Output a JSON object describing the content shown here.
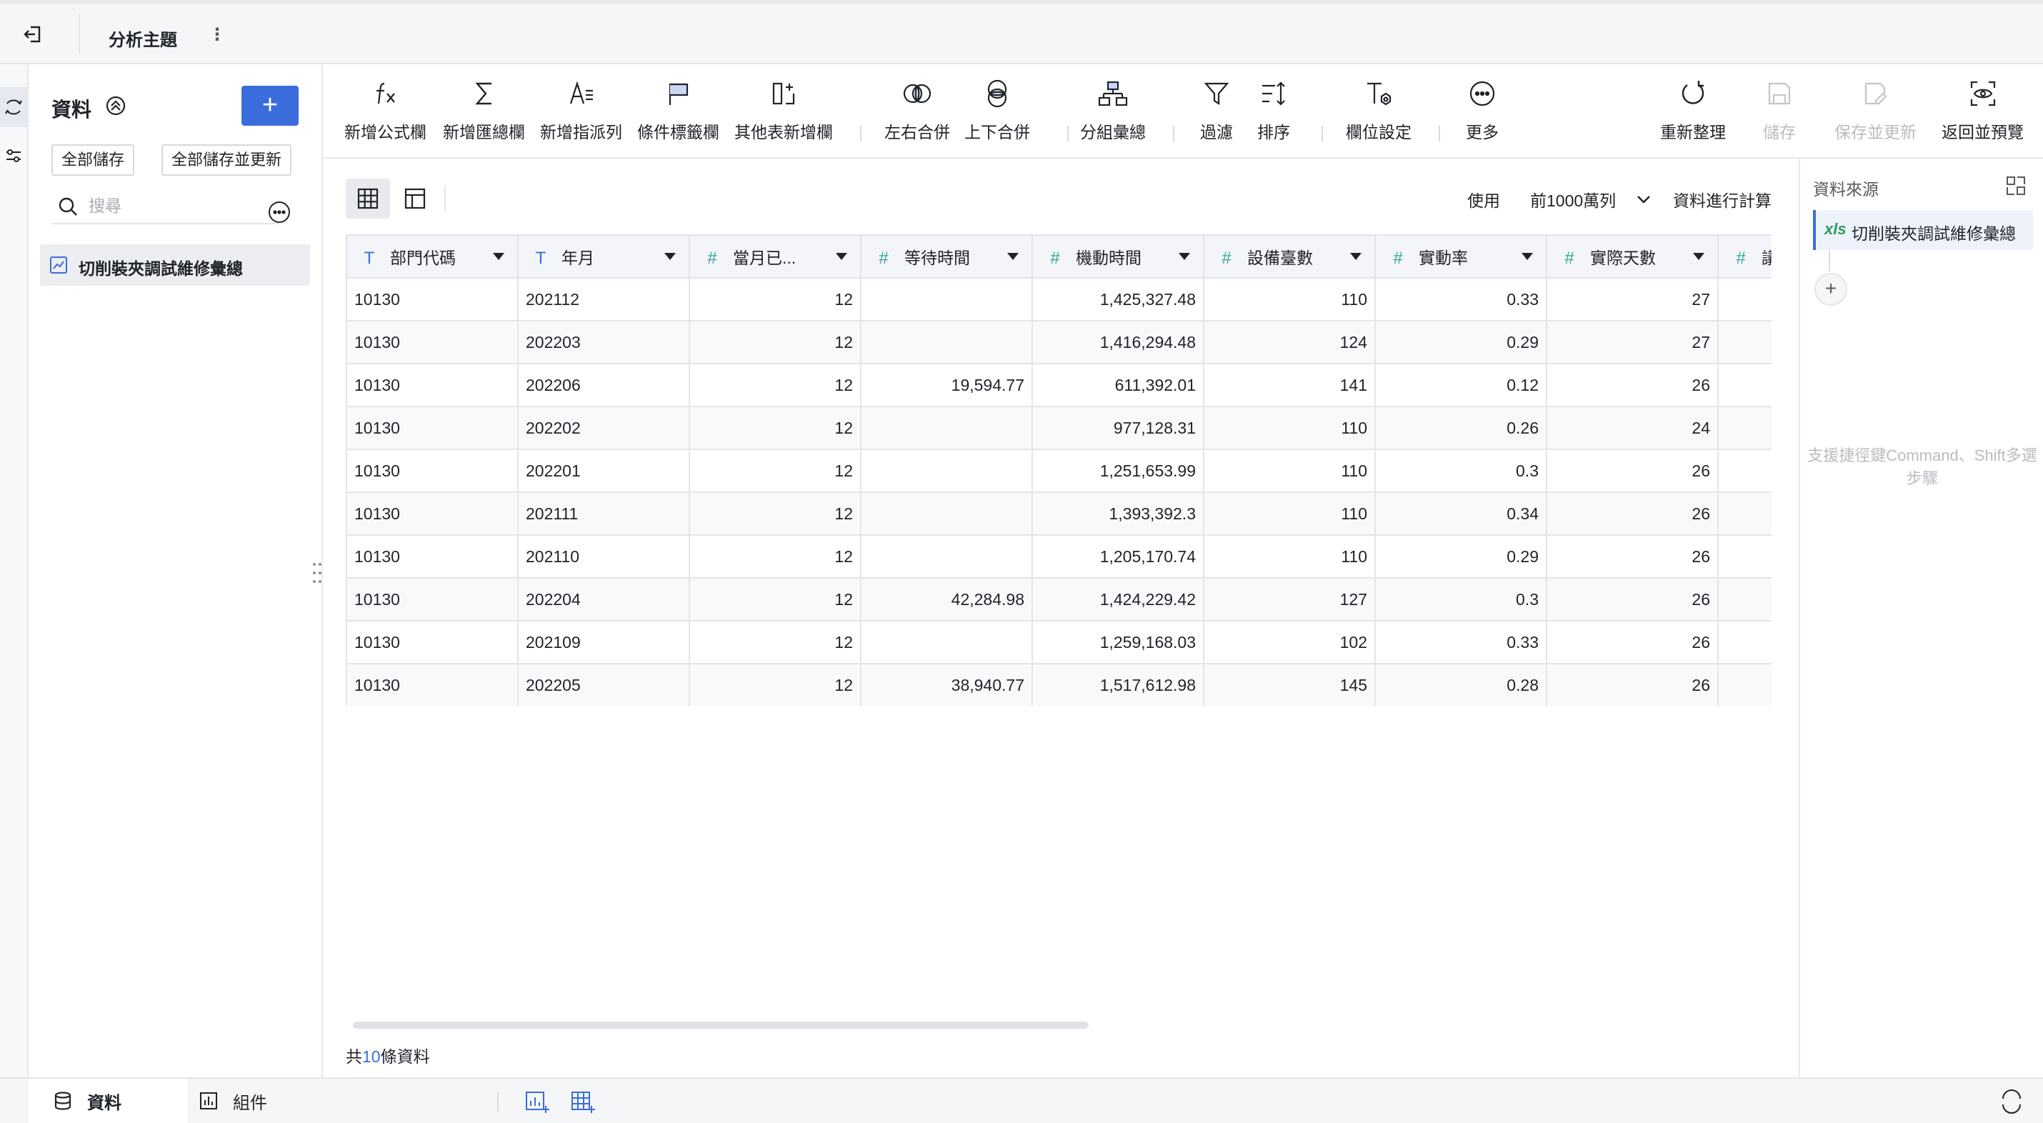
{
  "header": {
    "title": "分析主題",
    "kebab": "⋮"
  },
  "left_panel": {
    "title": "資料",
    "add_label": "+",
    "save_all": "全部儲存",
    "save_all_update": "全部儲存並更新",
    "search_placeholder": "搜尋",
    "dataset_name": "切削裝夾調試維修彙總"
  },
  "toolbar": {
    "add_formula": "新增公式欄",
    "add_summary": "新增匯總欄",
    "add_assign": "新增指派列",
    "condition_tag": "條件標籤欄",
    "other_table": "其他表新增欄",
    "lr_merge": "左右合併",
    "ud_merge": "上下合併",
    "group_summary": "分組彙總",
    "filter": "過濾",
    "sort": "排序",
    "field_settings": "欄位設定",
    "more": "更多",
    "refresh": "重新整理",
    "save": "儲存",
    "save_update": "保存並更新",
    "return_preview": "返回並預覽"
  },
  "main": {
    "use_label": "使用",
    "rows_option": "前1000萬列",
    "calc_label": "資料進行計算",
    "total_prefix": "共",
    "total_count": "10",
    "total_suffix": "條資料"
  },
  "table": {
    "columns": [
      {
        "label": "部門代碼",
        "type": "T"
      },
      {
        "label": "年月",
        "type": "T"
      },
      {
        "label": "當月已...",
        "type": "#"
      },
      {
        "label": "等待時間",
        "type": "#"
      },
      {
        "label": "機動時間",
        "type": "#"
      },
      {
        "label": "設備臺數",
        "type": "#"
      },
      {
        "label": "實動率",
        "type": "#"
      },
      {
        "label": "實際天數",
        "type": "#"
      },
      {
        "label": "議",
        "type": "#"
      }
    ],
    "rows": [
      [
        "10130",
        "202112",
        "12",
        "",
        "1,425,327.48",
        "110",
        "0.33",
        "27",
        ""
      ],
      [
        "10130",
        "202203",
        "12",
        "",
        "1,416,294.48",
        "124",
        "0.29",
        "27",
        ""
      ],
      [
        "10130",
        "202206",
        "12",
        "19,594.77",
        "611,392.01",
        "141",
        "0.12",
        "26",
        ""
      ],
      [
        "10130",
        "202202",
        "12",
        "",
        "977,128.31",
        "110",
        "0.26",
        "24",
        ""
      ],
      [
        "10130",
        "202201",
        "12",
        "",
        "1,251,653.99",
        "110",
        "0.3",
        "26",
        ""
      ],
      [
        "10130",
        "202111",
        "12",
        "",
        "1,393,392.3",
        "110",
        "0.34",
        "26",
        ""
      ],
      [
        "10130",
        "202110",
        "12",
        "",
        "1,205,170.74",
        "110",
        "0.29",
        "26",
        ""
      ],
      [
        "10130",
        "202204",
        "12",
        "42,284.98",
        "1,424,229.42",
        "127",
        "0.3",
        "26",
        ""
      ],
      [
        "10130",
        "202109",
        "12",
        "",
        "1,259,168.03",
        "102",
        "0.33",
        "26",
        ""
      ],
      [
        "10130",
        "202205",
        "12",
        "38,940.77",
        "1,517,612.98",
        "145",
        "0.28",
        "26",
        ""
      ]
    ]
  },
  "right_panel": {
    "title": "資料來源",
    "source_type": "xls",
    "source_name": "切削裝夾調試維修彙總",
    "add_node": "+",
    "hint": "支援捷徑鍵Command、Shift多選步驟"
  },
  "bottom": {
    "tab_data": "資料",
    "tab_component": "組件"
  },
  "colors": {
    "accent": "#3a6ddb",
    "numeric_type": "#33a89a",
    "xls_green": "#2f9a55"
  }
}
